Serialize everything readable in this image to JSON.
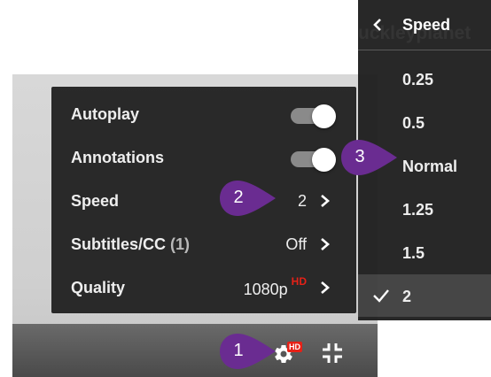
{
  "watermark": "uckleyplanet",
  "settings": {
    "rows": [
      {
        "label": "Autoplay",
        "type": "toggle",
        "on": true
      },
      {
        "label": "Annotations",
        "type": "toggle",
        "on": true
      },
      {
        "label": "Speed",
        "value": "2"
      },
      {
        "label": "Subtitles/CC",
        "count": "(1)",
        "value": "Off"
      },
      {
        "label": "Quality",
        "value": "1080p",
        "badge": "HD"
      }
    ]
  },
  "controls": {
    "settings_badge": "HD",
    "icons": [
      "gear-icon",
      "exit-fullscreen-icon"
    ]
  },
  "speed_menu": {
    "title": "Speed",
    "options": [
      "0.25",
      "0.5",
      "Normal",
      "1.25",
      "1.5",
      "2"
    ],
    "selected": "2"
  },
  "callouts": [
    "1",
    "2",
    "3"
  ],
  "colors": {
    "callout": "#6a2c91",
    "hd_red": "#e62117",
    "menu_bg": "#1c1c1c"
  }
}
